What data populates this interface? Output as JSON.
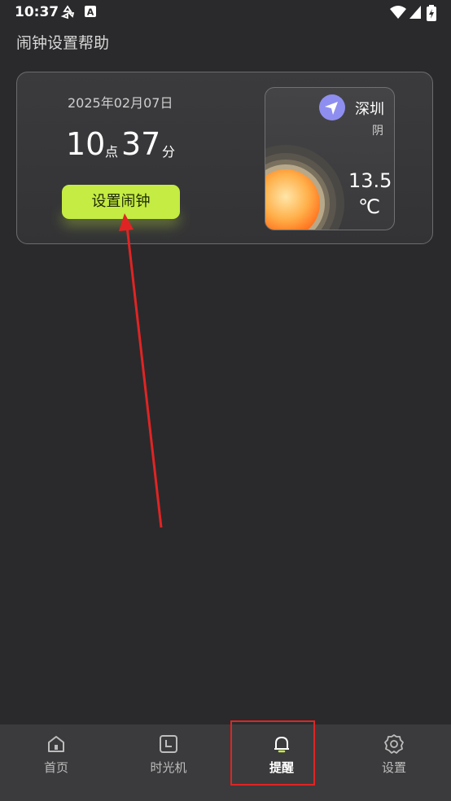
{
  "status_bar": {
    "time": "10:37",
    "icons": [
      "recycle-icon",
      "a-notification-icon",
      "wifi-icon",
      "signal-icon",
      "battery-icon"
    ]
  },
  "page": {
    "title": "闹钟设置帮助"
  },
  "clock_card": {
    "date": "2025年02月07日",
    "hour": "10",
    "hour_unit": "点",
    "minute": "37",
    "minute_unit": "分",
    "set_alarm_label": "设置闹钟"
  },
  "weather": {
    "city": "深圳",
    "condition": "阴",
    "temperature": "13.5",
    "unit": "℃"
  },
  "bottom_nav": {
    "items": [
      {
        "label": "首页",
        "icon": "home-icon"
      },
      {
        "label": "时光机",
        "icon": "time-machine-icon"
      },
      {
        "label": "提醒",
        "icon": "bell-icon",
        "active": true
      },
      {
        "label": "设置",
        "icon": "gear-icon"
      }
    ]
  },
  "colors": {
    "accent": "#c4ec42",
    "annotation": "#e02424",
    "background": "#2a2a2c"
  }
}
